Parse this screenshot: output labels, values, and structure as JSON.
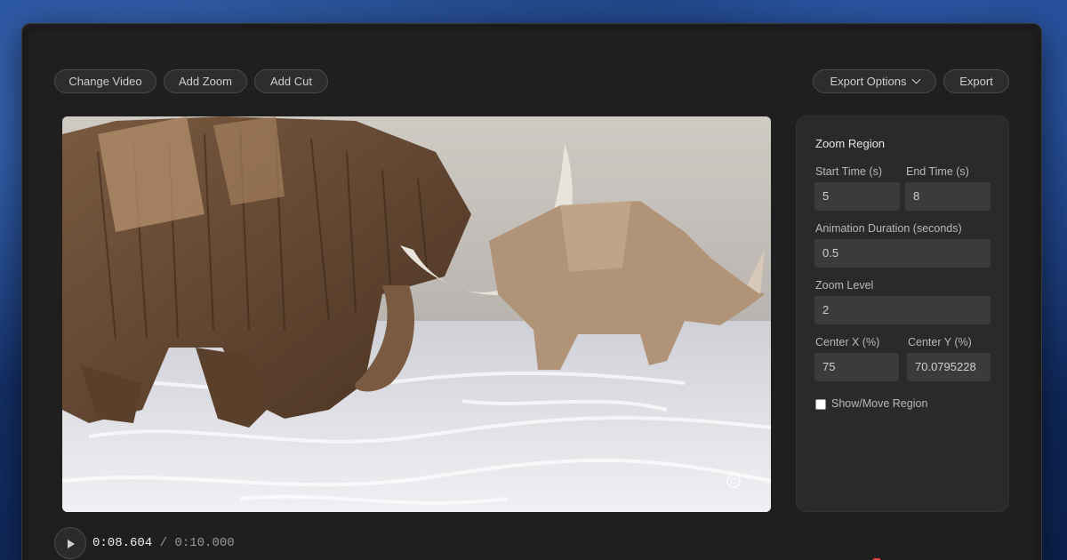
{
  "toolbar": {
    "change_video": "Change Video",
    "add_zoom": "Add Zoom",
    "add_cut": "Add Cut",
    "export_options": "Export Options",
    "export": "Export"
  },
  "zoom_panel": {
    "title": "Zoom Region",
    "start_time_label": "Start Time (s)",
    "start_time_value": "5",
    "end_time_label": "End Time (s)",
    "end_time_value": "8",
    "animation_duration_label": "Animation Duration (seconds)",
    "animation_duration_value": "0.5",
    "zoom_level_label": "Zoom Level",
    "zoom_level_value": "2",
    "center_x_label": "Center X (%)",
    "center_x_value": "75",
    "center_y_label": "Center Y (%)",
    "center_y_value": "70.0795228",
    "show_move_label": "Show/Move Region",
    "show_move_checked": false
  },
  "player": {
    "current_time": "0:08.604",
    "separator": "/",
    "total_time": "0:10.000",
    "progress_fraction": 0.86
  },
  "colors": {
    "playhead": "#e0453e",
    "panel_bg": "#2a2a2a",
    "window_bg": "#1f1f1f"
  },
  "icons": {
    "play": "play-icon",
    "chevron": "chevron-down-icon",
    "watermark": "openai-logo-icon"
  }
}
